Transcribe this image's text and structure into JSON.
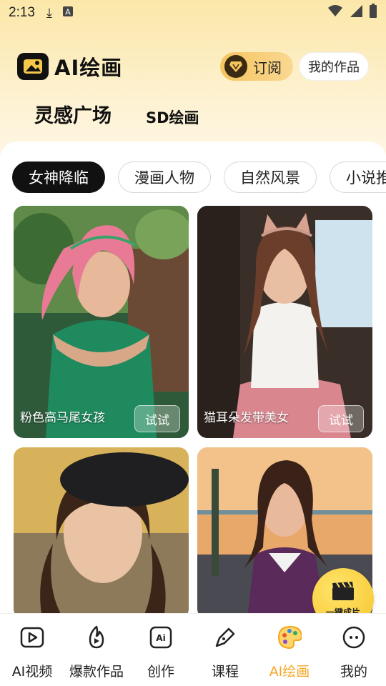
{
  "status_bar": {
    "time": "2:13"
  },
  "header": {
    "title": "AI绘画",
    "subscribe_label": "订阅",
    "my_works_label": "我的作品"
  },
  "mode_tabs": [
    {
      "label": "灵感广场",
      "active": true
    },
    {
      "label": "SD绘画",
      "active": false
    }
  ],
  "categories": [
    {
      "label": "女神降临",
      "active": true
    },
    {
      "label": "漫画人物",
      "active": false
    },
    {
      "label": "自然风景",
      "active": false
    },
    {
      "label": "小说推",
      "active": false
    }
  ],
  "cards": [
    {
      "label": "粉色高马尾女孩",
      "button": "试试"
    },
    {
      "label": "猫耳朵发带美女",
      "button": "试试"
    },
    {
      "label": "",
      "button": ""
    },
    {
      "label": "",
      "button": ""
    }
  ],
  "fab": {
    "label": "一键成片"
  },
  "bottom_nav": [
    {
      "label": "AI视频",
      "icon": "play-icon",
      "active": false
    },
    {
      "label": "爆款作品",
      "icon": "fire-play-icon",
      "active": false
    },
    {
      "label": "创作",
      "icon": "ai-icon",
      "active": false
    },
    {
      "label": "课程",
      "icon": "pen-icon",
      "active": false
    },
    {
      "label": "AI绘画",
      "icon": "palette-icon",
      "active": true
    },
    {
      "label": "我的",
      "icon": "face-icon",
      "active": false
    }
  ],
  "colors": {
    "accent": "#f5a623",
    "chip_active_bg": "#111111",
    "header_bg": "#fbe7a8"
  }
}
